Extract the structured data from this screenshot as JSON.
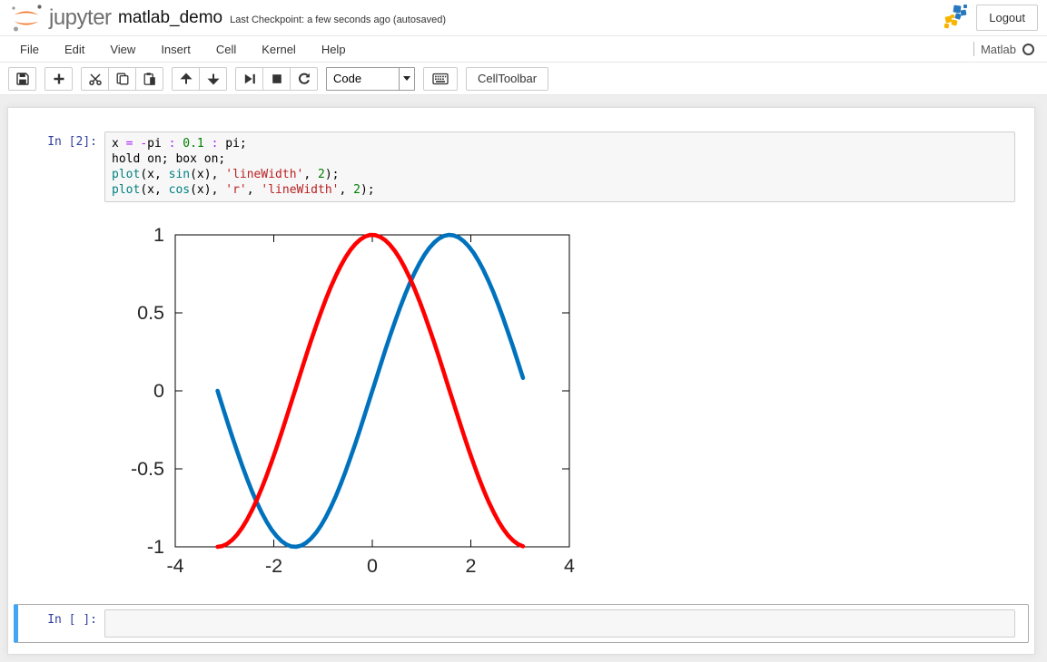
{
  "header": {
    "logo_text": "jupyter",
    "notebook_title": "matlab_demo",
    "checkpoint_text": "Last Checkpoint: a few seconds ago (autosaved)",
    "logout_label": "Logout"
  },
  "menubar": {
    "items": [
      "File",
      "Edit",
      "View",
      "Insert",
      "Cell",
      "Kernel",
      "Help"
    ],
    "kernel_name": "Matlab",
    "kernel_status": "idle"
  },
  "toolbar": {
    "buttons": [
      {
        "name": "save",
        "icon": "floppy-icon"
      },
      {
        "name": "add-cell",
        "icon": "plus-icon"
      },
      {
        "name": "cut-cell",
        "icon": "scissors-icon"
      },
      {
        "name": "copy-cell",
        "icon": "copy-icon"
      },
      {
        "name": "paste-cell",
        "icon": "paste-icon"
      },
      {
        "name": "move-cell-up",
        "icon": "arrow-up-icon"
      },
      {
        "name": "move-cell-down",
        "icon": "arrow-down-icon"
      },
      {
        "name": "run-cell",
        "icon": "run-icon"
      },
      {
        "name": "interrupt-kernel",
        "icon": "stop-icon"
      },
      {
        "name": "restart-kernel",
        "icon": "restart-icon"
      }
    ],
    "cell_type_value": "Code",
    "celltoolbar_label": "CellToolbar"
  },
  "code_cell": {
    "prompt": "In [2]:",
    "lines": [
      [
        [
          "x ",
          "plain"
        ],
        [
          "=",
          "operator"
        ],
        [
          " ",
          "plain"
        ],
        [
          "-",
          "operator"
        ],
        [
          "pi ",
          "plain"
        ],
        [
          ":",
          "operator"
        ],
        [
          " ",
          "plain"
        ],
        [
          "0.1",
          "number"
        ],
        [
          " ",
          "plain"
        ],
        [
          ":",
          "operator"
        ],
        [
          " pi;",
          "plain"
        ]
      ],
      [
        [
          "hold on; box on;",
          "plain"
        ]
      ],
      [
        [
          "plot",
          "builtin"
        ],
        [
          "(x, ",
          "plain"
        ],
        [
          "sin",
          "builtin"
        ],
        [
          "(x), ",
          "plain"
        ],
        [
          "'lineWidth'",
          "string"
        ],
        [
          ", ",
          "plain"
        ],
        [
          "2",
          "number"
        ],
        [
          ");",
          "plain"
        ]
      ],
      [
        [
          "plot",
          "builtin"
        ],
        [
          "(x, ",
          "plain"
        ],
        [
          "cos",
          "builtin"
        ],
        [
          "(x), ",
          "plain"
        ],
        [
          "'r'",
          "string"
        ],
        [
          ", ",
          "plain"
        ],
        [
          "'lineWidth'",
          "string"
        ],
        [
          ", ",
          "plain"
        ],
        [
          "2",
          "number"
        ],
        [
          ");",
          "plain"
        ]
      ]
    ]
  },
  "empty_cell": {
    "prompt": "In [ ]:"
  },
  "syntax_colors": {
    "plain": "#000000",
    "operator": "#AA22FF",
    "number": "#008000",
    "string": "#BA2121",
    "builtin": "#008080",
    "prompt": "#303F9F"
  },
  "chart_data": {
    "type": "line",
    "title": "",
    "xlabel": "",
    "ylabel": "",
    "x_start": -3.14159,
    "x_step": 0.1,
    "x_count": 63,
    "series": [
      {
        "name": "sin(x)",
        "function": "sin",
        "color": "#0072BD",
        "line_width": 2
      },
      {
        "name": "cos(x)",
        "function": "cos",
        "color": "#FF0000",
        "line_width": 2
      }
    ],
    "xlim": [
      -4,
      4
    ],
    "ylim": [
      -1,
      1
    ],
    "xticks": [
      -4,
      -2,
      0,
      2,
      4
    ],
    "yticks": [
      1,
      0.5,
      0,
      -0.5,
      -1
    ],
    "box": true,
    "grid": false,
    "legend": null,
    "tick_label_color": "#262626",
    "axis_color": "#000000"
  }
}
